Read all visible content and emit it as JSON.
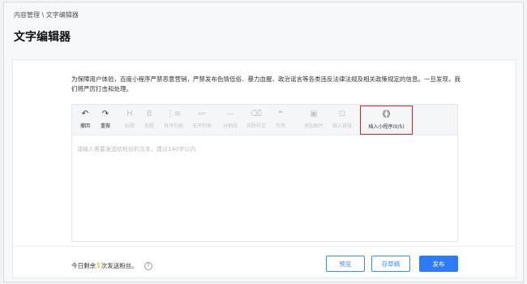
{
  "breadcrumb": "内容管理 \\ 文字编辑器",
  "page_title": "文字编辑器",
  "notice": "为保障用户体验，百度小程序严禁恶意营销，严禁发布色情低俗、暴力血腥、政治谣言等各类违反法律法规及相关政策规定的信息。一旦发现，我们将严厉打击和处理。",
  "toolbar": {
    "undo": {
      "icon": "↶",
      "label": "撤回"
    },
    "redo": {
      "icon": "↷",
      "label": "重做"
    },
    "heading": {
      "icon": "H",
      "label": "标题"
    },
    "bold": {
      "icon": "B",
      "label": "加粗"
    },
    "ordered_list": {
      "icon": "⋮≡",
      "label": "有序列表"
    },
    "unordered_list": {
      "icon": "≔",
      "label": "无序列表"
    },
    "divider": {
      "icon": "—",
      "label": "分割线"
    },
    "clear_format": {
      "icon": "⌫",
      "label": "去除样式"
    },
    "quote": {
      "icon": "❝",
      "label": "引用"
    },
    "add_image": {
      "icon": "▣",
      "label": "添加图片"
    },
    "insert_link": {
      "icon": "⊡",
      "label": "插入链接"
    },
    "insert_miniprogram": {
      "icon": "《》",
      "label": "插入小程序(0/5)"
    }
  },
  "editor": {
    "placeholder": "请输入需要发送给粉丝的文本，建议140字以内"
  },
  "footer": {
    "quota_prefix": "今日剩余",
    "quota_count": "5",
    "quota_suffix": "次发送粉丝。",
    "help_icon": "?",
    "preview_label": "预览",
    "save_draft_label": "存草稿",
    "publish_label": "发布"
  },
  "colors": {
    "accent": "#2f7bf5",
    "highlight_box": "#c5282f",
    "quota_number": "#f0a020"
  }
}
